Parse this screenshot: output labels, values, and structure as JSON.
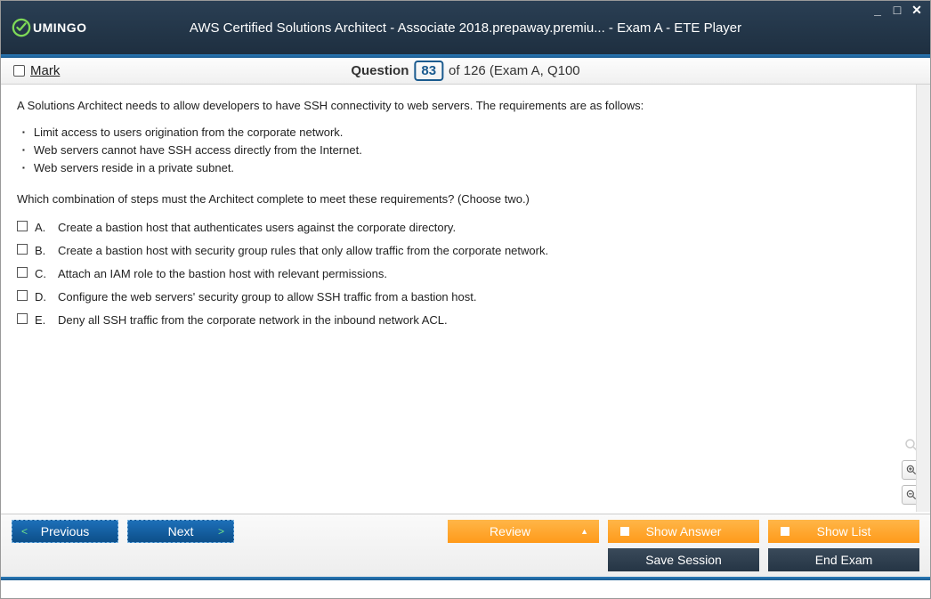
{
  "logo_text": "UMINGO",
  "title": "AWS Certified Solutions Architect - Associate 2018.prepaway.premiu... - Exam A - ETE Player",
  "mark_label": "Mark",
  "question_word": "Question",
  "question_number": "83",
  "question_of": "of 126 (Exam A, Q100",
  "intro": "A Solutions Architect needs to allow developers to have SSH connectivity to web servers. The requirements are as follows:",
  "bullets": [
    "Limit access to users origination from the corporate network.",
    "Web servers cannot have SSH access directly from the Internet.",
    "Web servers reside in a private subnet."
  ],
  "subquestion": "Which combination of steps must the Architect complete to meet these requirements? (Choose two.)",
  "options": [
    {
      "letter": "A.",
      "text": "Create a bastion host that authenticates users against the corporate directory."
    },
    {
      "letter": "B.",
      "text": "Create a bastion host with security group rules that only allow traffic from the corporate network."
    },
    {
      "letter": "C.",
      "text": "Attach an IAM role to the bastion host with relevant permissions."
    },
    {
      "letter": "D.",
      "text": "Configure the web servers' security group to allow SSH traffic from a bastion host."
    },
    {
      "letter": "E.",
      "text": "Deny all SSH traffic from the corporate network in the inbound network ACL."
    }
  ],
  "buttons": {
    "previous": "Previous",
    "next": "Next",
    "review": "Review",
    "show_answer": "Show Answer",
    "show_list": "Show List",
    "save_session": "Save Session",
    "end_exam": "End Exam"
  }
}
